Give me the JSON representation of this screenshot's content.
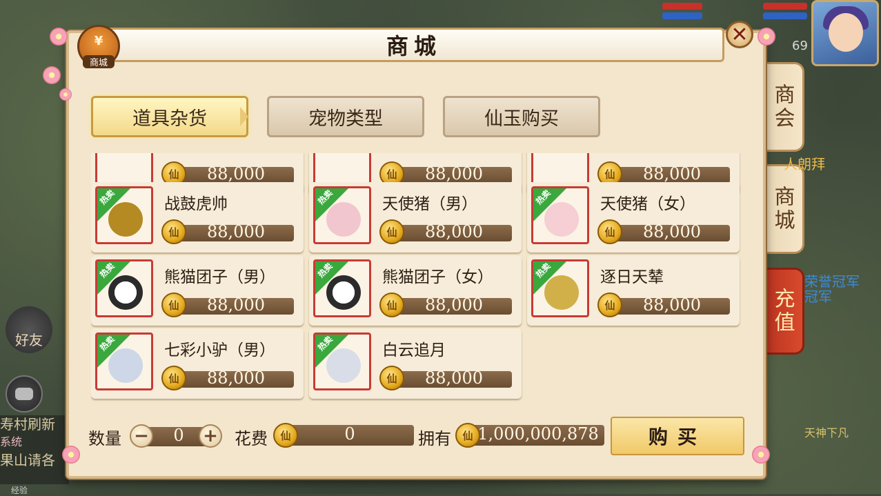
{
  "background": {
    "level": "69",
    "side_buttons": [
      "商会",
      "商城",
      "充值"
    ],
    "friend_label": "好友",
    "chat_lines": [
      "寿村刷新",
      "系统",
      "果山请各"
    ],
    "bottom_hint": "经验",
    "float_texts": [
      "人朗拜",
      "荣誉冠军",
      "冠军",
      "天神下凡"
    ]
  },
  "dialog": {
    "title": "商城",
    "shop_icon_label": "商城",
    "shop_icon_symbol": "¥",
    "close_symbol": "✕",
    "tabs": [
      {
        "label": "道具杂货",
        "active": true
      },
      {
        "label": "宠物类型",
        "active": false
      },
      {
        "label": "仙玉购买",
        "active": false
      }
    ],
    "hot_badge": "热卖",
    "coin_symbol": "仙",
    "items_partial": [
      {
        "price": "88,000"
      },
      {
        "price": "88,000"
      },
      {
        "price": "88,000"
      }
    ],
    "items": [
      {
        "name": "战鼓虎帅",
        "price": "88,000",
        "color": "#b58a22"
      },
      {
        "name": "天使猪（男）",
        "price": "88,000",
        "color": "#f2c6cf"
      },
      {
        "name": "天使猪（女）",
        "price": "88,000",
        "color": "#f5cfd4"
      },
      {
        "name": "熊猫团子（男）",
        "price": "88,000",
        "color": "#2b2b2b"
      },
      {
        "name": "熊猫团子（女）",
        "price": "88,000",
        "color": "#2b2b2b"
      },
      {
        "name": "逐日天辇",
        "price": "88,000",
        "color": "#d1b04a"
      },
      {
        "name": "七彩小驴（男）",
        "price": "88,000",
        "color": "#cdd7e8"
      },
      {
        "name": "白云追月",
        "price": "88,000",
        "color": "#d9dde8"
      }
    ],
    "footer": {
      "quantity_label": "数量",
      "minus": "−",
      "plus": "+",
      "quantity_value": "0",
      "cost_label": "花费",
      "cost_value": "0",
      "own_label": "拥有",
      "own_value": "1,000,000,878",
      "buy_label": "购买"
    }
  }
}
